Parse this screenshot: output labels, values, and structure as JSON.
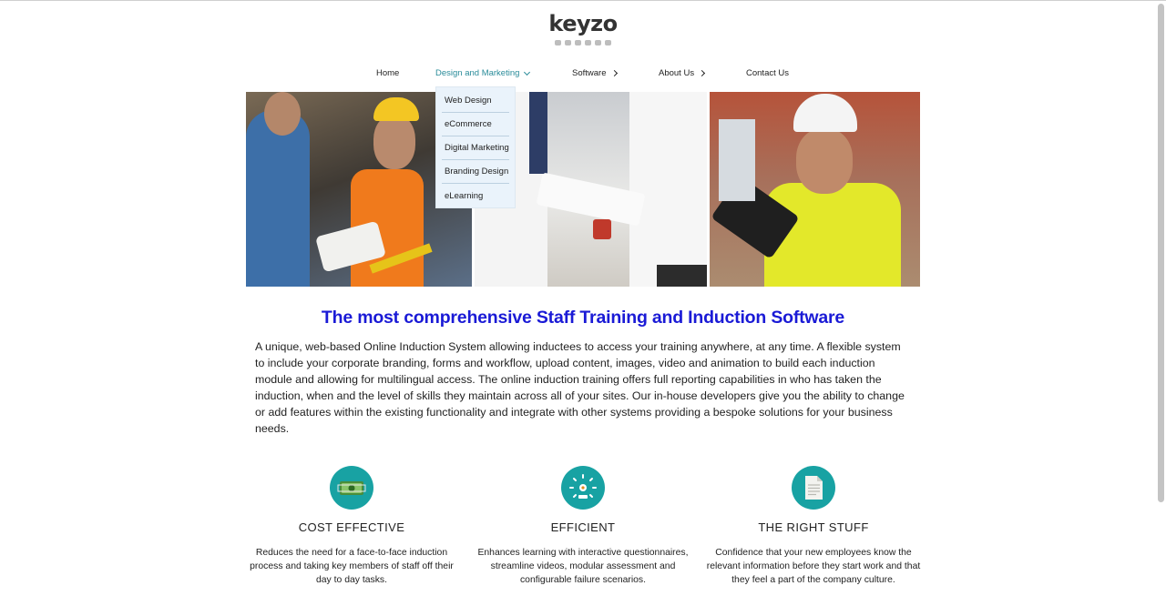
{
  "brand": {
    "logo_text": "keyzo",
    "accent": "#18a2a3",
    "headline_color": "#1a1ad6",
    "nav_active_color": "#2a8c9a"
  },
  "nav": {
    "home": "Home",
    "design_marketing": "Design and Marketing",
    "software": "Software",
    "about": "About Us",
    "contact": "Contact Us"
  },
  "dropdown": {
    "items": [
      "Web Design",
      "eCommerce",
      "Digital Marketing",
      "Branding Design",
      "eLearning"
    ]
  },
  "hero": {
    "panels": [
      "construction-worker-with-level",
      "handshake-with-clipboard",
      "worker-with-tablet"
    ]
  },
  "main": {
    "headline": "The most comprehensive Staff Training and Induction Software",
    "intro": "A unique, web-based Online Induction System allowing inductees to access your training anywhere, at any time. A flexible system to include your corporate branding, forms and workflow, upload content, images, video and animation to build each induction module and allowing for multilingual access. The online induction training offers full reporting capabilities in who has taken the induction, when and the level of skills they maintain across all of your sites. Our in-house developers give you the ability to change or add features within the existing functionality and integrate with other systems providing a bespoke solutions for your business needs."
  },
  "features": [
    {
      "icon": "money-icon",
      "title": "COST EFFECTIVE",
      "text": "Reduces the need for a face-to-face induction process and taking key members of staff off their day to day tasks."
    },
    {
      "icon": "speedometer-icon",
      "title": "EFFICIENT",
      "text": "Enhances learning with interactive questionnaires, streamline videos, modular assessment and configurable failure scenarios."
    },
    {
      "icon": "document-icon",
      "title": "THE RIGHT STUFF",
      "text": "Confidence that your new employees know the relevant information before they start work and that they feel a part of the company culture."
    }
  ]
}
